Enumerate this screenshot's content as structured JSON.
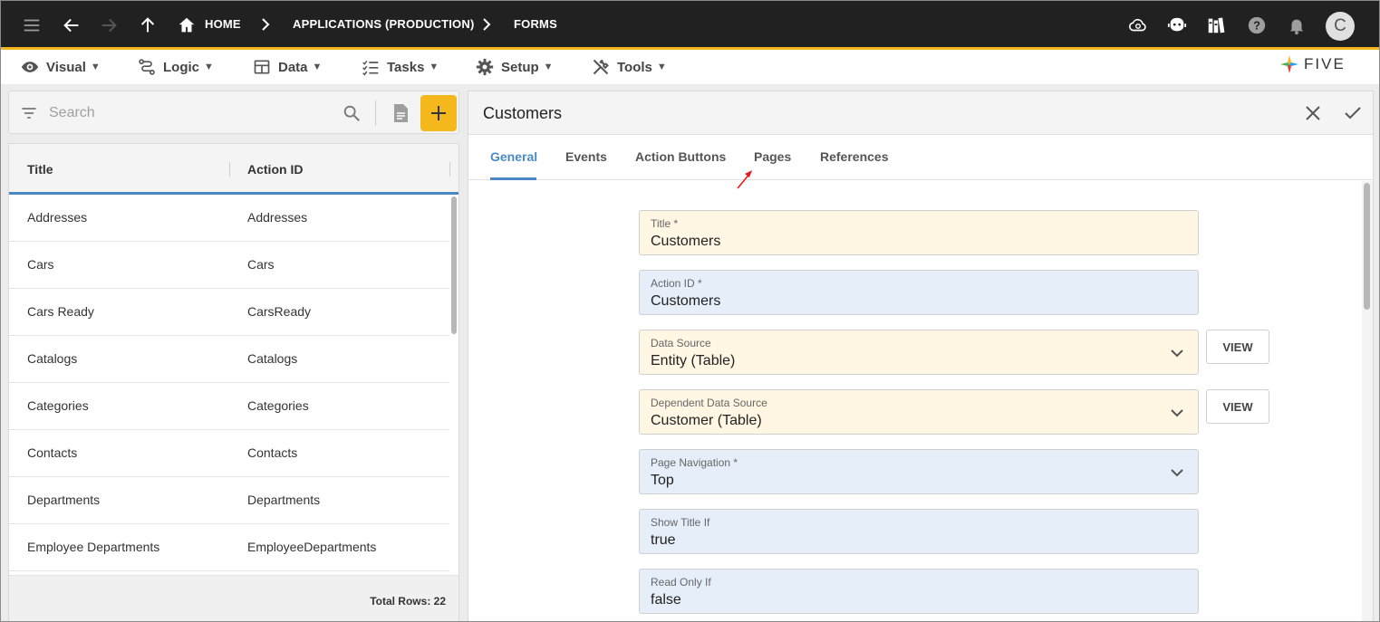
{
  "topbar": {
    "breadcrumbs": [
      "HOME",
      "APPLICATIONS (PRODUCTION)",
      "FORMS"
    ],
    "avatar_initial": "C",
    "icons": [
      "menu-icon",
      "back-arrow-icon",
      "forward-arrow-icon",
      "up-arrow-icon",
      "home-icon",
      "cloud-sync-icon",
      "chat-bot-icon",
      "library-icon",
      "help-icon",
      "bell-icon"
    ]
  },
  "menu": {
    "items": [
      {
        "label": "Visual",
        "icon": "eye-icon"
      },
      {
        "label": "Logic",
        "icon": "logic-icon"
      },
      {
        "label": "Data",
        "icon": "table-icon"
      },
      {
        "label": "Tasks",
        "icon": "checklist-icon"
      },
      {
        "label": "Setup",
        "icon": "gear-icon"
      },
      {
        "label": "Tools",
        "icon": "tools-icon"
      }
    ],
    "caret": "▼",
    "logo_text": "FIVE"
  },
  "search": {
    "placeholder": "Search",
    "value": ""
  },
  "list": {
    "columns": [
      "Title",
      "Action ID"
    ],
    "rows": [
      {
        "title": "Addresses",
        "action_id": "Addresses"
      },
      {
        "title": "Cars",
        "action_id": "Cars"
      },
      {
        "title": "Cars Ready",
        "action_id": "CarsReady"
      },
      {
        "title": "Catalogs",
        "action_id": "Catalogs"
      },
      {
        "title": "Categories",
        "action_id": "Categories"
      },
      {
        "title": "Contacts",
        "action_id": "Contacts"
      },
      {
        "title": "Departments",
        "action_id": "Departments"
      },
      {
        "title": "Employee Departments",
        "action_id": "EmployeeDepartments"
      }
    ],
    "total_rows": "Total Rows: 22"
  },
  "detail": {
    "title": "Customers",
    "tabs": [
      "General",
      "Events",
      "Action Buttons",
      "Pages",
      "References"
    ],
    "active_tab": "General",
    "view_label": "VIEW",
    "fields": [
      {
        "label": "Title *",
        "value": "Customers",
        "color": "yellow",
        "dropdown": false,
        "view": false
      },
      {
        "label": "Action ID *",
        "value": "Customers",
        "color": "blue",
        "dropdown": false,
        "view": false
      },
      {
        "label": "Data Source",
        "value": "Entity (Table)",
        "color": "yellow",
        "dropdown": true,
        "view": true
      },
      {
        "label": "Dependent Data Source",
        "value": "Customer (Table)",
        "color": "yellow",
        "dropdown": true,
        "view": true
      },
      {
        "label": "Page Navigation *",
        "value": "Top",
        "color": "blue",
        "dropdown": true,
        "view": false
      },
      {
        "label": "Show Title If",
        "value": "true",
        "color": "blue",
        "dropdown": false,
        "view": false
      },
      {
        "label": "Read Only If",
        "value": "false",
        "color": "blue",
        "dropdown": false,
        "view": false
      }
    ]
  },
  "colors": {
    "accent": "#f5b81c",
    "tab_active": "#4a89c8",
    "field_yellow": "#fff6e3",
    "field_blue": "#e5eef9",
    "annotation_arrow": "#e02020"
  }
}
